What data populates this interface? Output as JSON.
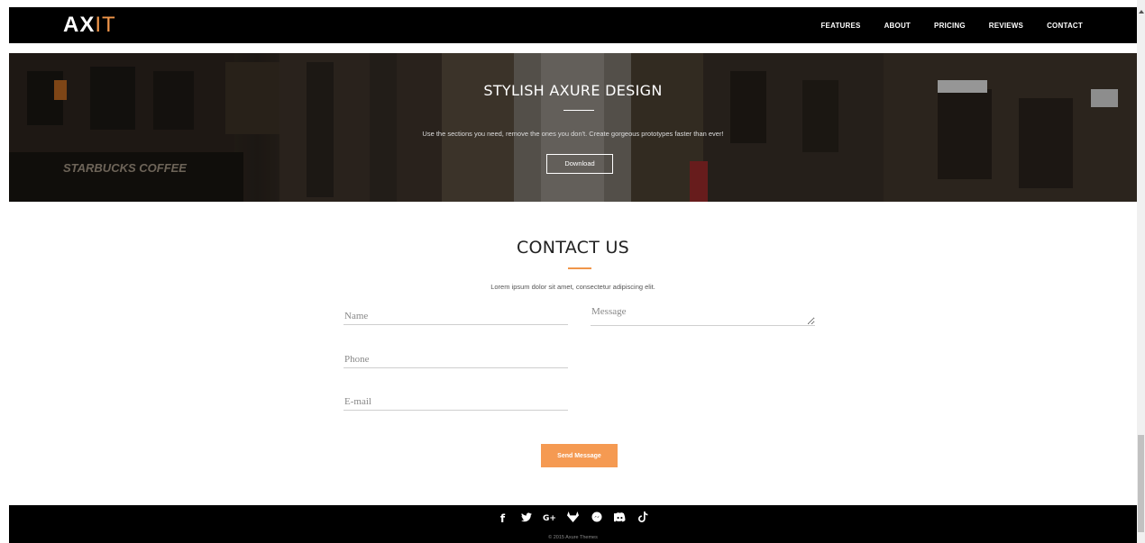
{
  "navbar": {
    "logo_part1": "AX",
    "logo_part2": "IT",
    "items": [
      {
        "label": "FEATURES"
      },
      {
        "label": "ABOUT"
      },
      {
        "label": "PRICING"
      },
      {
        "label": "REVIEWS"
      },
      {
        "label": "CONTACT"
      }
    ]
  },
  "hero": {
    "title": "STYLISH AXURE DESIGN",
    "subtitle": "Use the sections you need, remove the ones you don't. Create gorgeous prototypes faster than ever!",
    "button_label": "Download"
  },
  "contact": {
    "title": "CONTACT US",
    "subtitle": "Lorem ipsum dolor sit amet, consectetur adipiscing elit.",
    "fields": {
      "name_placeholder": "Name",
      "phone_placeholder": "Phone",
      "email_placeholder": "E-mail",
      "message_placeholder": "Message"
    },
    "send_label": "Send Message"
  },
  "footer": {
    "social_icons": [
      "facebook-icon",
      "twitter-icon",
      "google-plus-icon",
      "gitlab-icon",
      "messenger-icon",
      "discord-icon",
      "tiktok-icon"
    ],
    "copyright": "© 2015 Axure Themes"
  },
  "colors": {
    "accent": "#f59a52",
    "navbar_bg": "#000000",
    "footer_bg": "#000000"
  }
}
